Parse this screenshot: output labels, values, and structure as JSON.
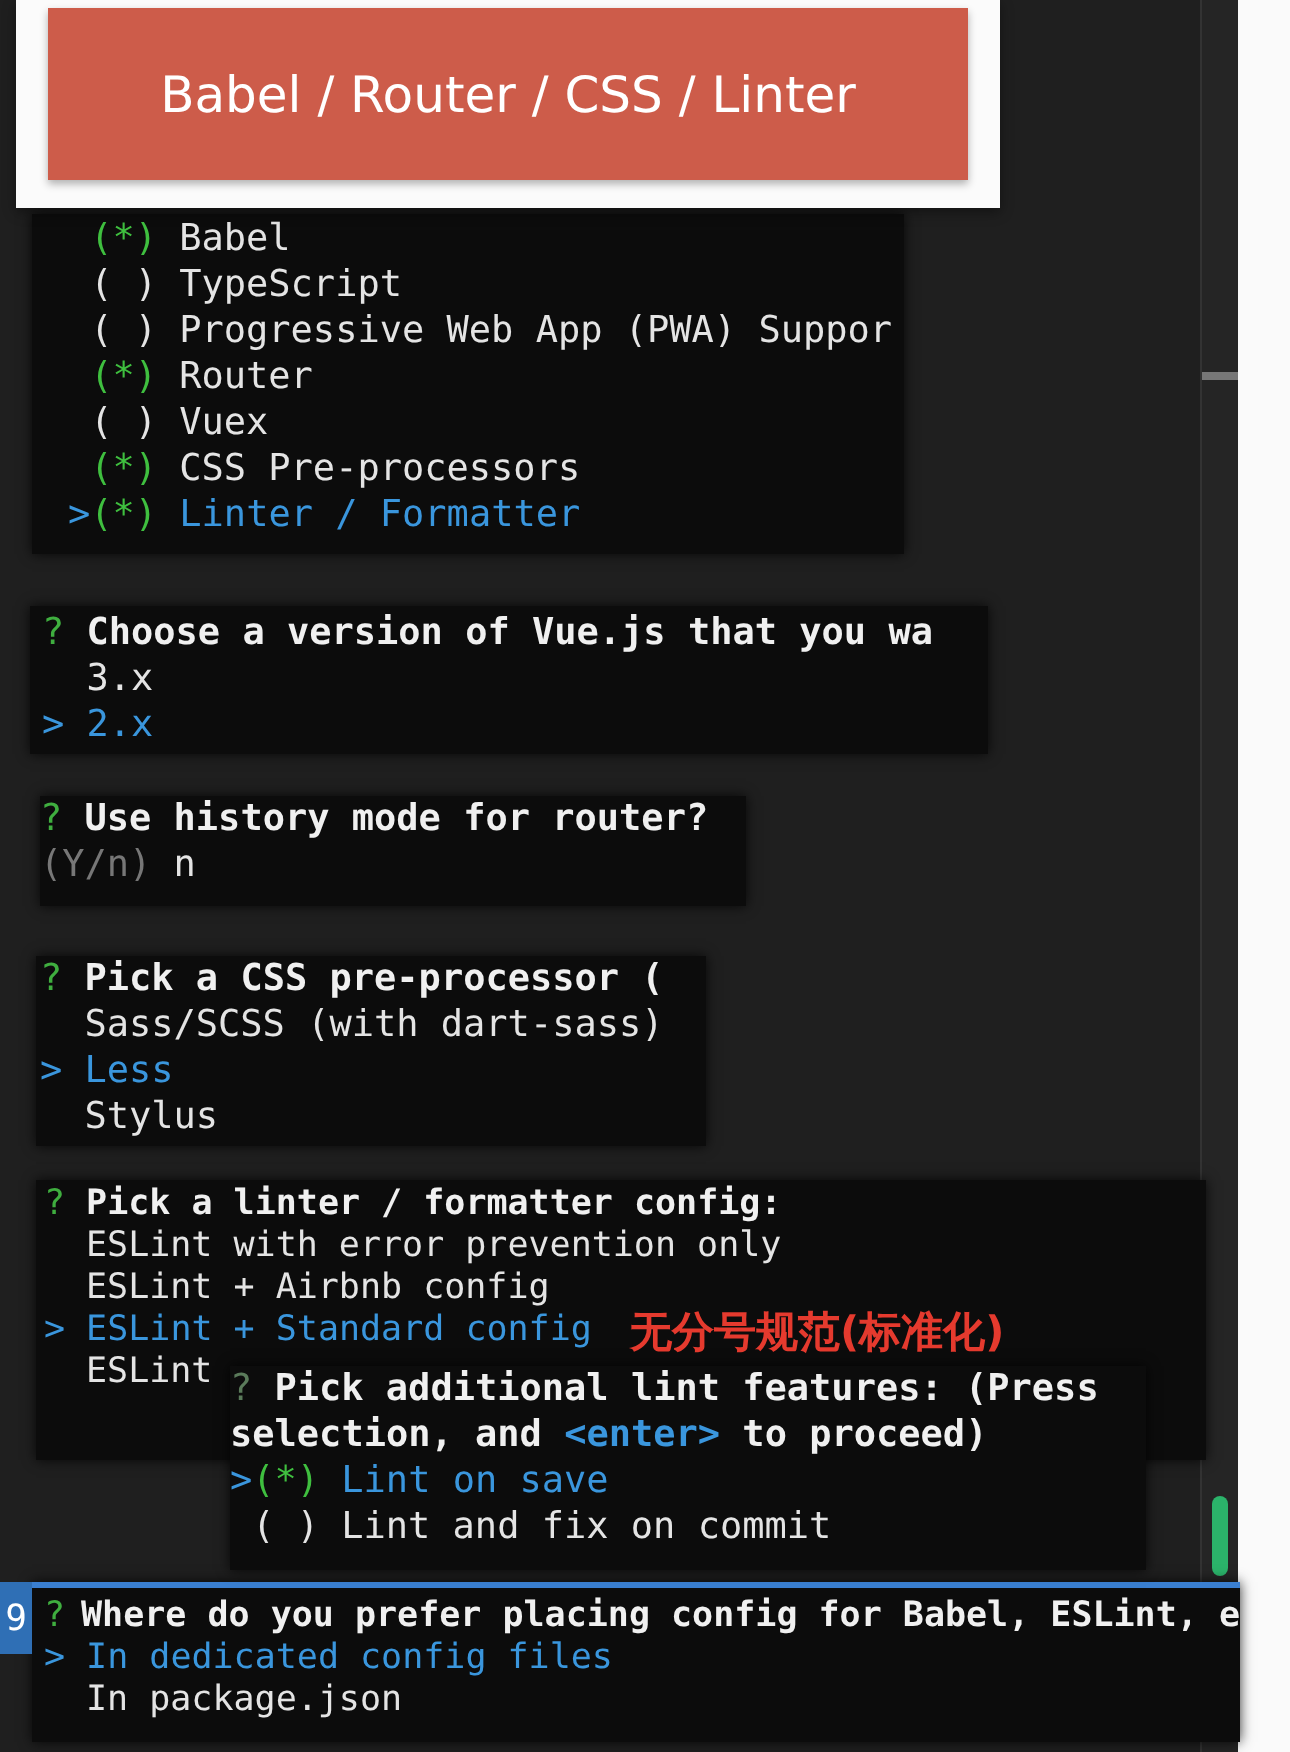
{
  "banner": {
    "title": "Babel / Router / CSS / Linter"
  },
  "panels": [
    {
      "kind": "checkbox_list",
      "pointer": ">",
      "items": [
        {
          "mark": "(*)",
          "label": "Babel",
          "checked": true,
          "selected": false
        },
        {
          "mark": "( )",
          "label": "TypeScript",
          "checked": false,
          "selected": false
        },
        {
          "mark": "( )",
          "label": "Progressive Web App (PWA) Suppor",
          "checked": false,
          "selected": false
        },
        {
          "mark": "(*)",
          "label": "Router",
          "checked": true,
          "selected": false
        },
        {
          "mark": "( )",
          "label": "Vuex",
          "checked": false,
          "selected": false
        },
        {
          "mark": "(*)",
          "label": "CSS Pre-processors",
          "checked": true,
          "selected": false
        },
        {
          "mark": "(*)",
          "label": "Linter / Formatter",
          "checked": true,
          "selected": true
        }
      ]
    },
    {
      "kind": "list",
      "prompt": "?",
      "question": "Choose a version of Vue.js that you wa",
      "pointer": ">",
      "options": [
        {
          "label": "3.x",
          "selected": false
        },
        {
          "label": "2.x",
          "selected": true
        }
      ]
    },
    {
      "kind": "confirm",
      "prompt": "?",
      "question": "Use history mode for router?",
      "hint": "(Y/n)",
      "answer": "n"
    },
    {
      "kind": "list",
      "prompt": "?",
      "question": "Pick a CSS pre-processor (",
      "pointer": ">",
      "options": [
        {
          "label": "Sass/SCSS (with dart-sass)",
          "selected": false
        },
        {
          "label": "Less",
          "selected": true
        },
        {
          "label": "Stylus",
          "selected": false
        }
      ]
    },
    {
      "kind": "list",
      "prompt": "?",
      "question": "Pick a linter / formatter config:",
      "pointer": ">",
      "annotation": "无分号规范(标准化)",
      "options": [
        {
          "label": "ESLint with error prevention only",
          "selected": false
        },
        {
          "label": "ESLint + Airbnb config",
          "selected": false
        },
        {
          "label": "ESLint + Standard config",
          "selected": true
        },
        {
          "label": "ESLint",
          "selected": false
        }
      ],
      "popup": {
        "prompt": "?",
        "question": "Pick additional lint features: (Press",
        "continuation": [
          {
            "text": "selection, and ",
            "highlight": false
          },
          {
            "text": "<enter>",
            "highlight": true
          },
          {
            "text": " to proceed)",
            "highlight": false
          }
        ],
        "pointer": ">",
        "items": [
          {
            "mark": "(*)",
            "label": "Lint on save",
            "checked": true,
            "selected": true
          },
          {
            "mark": "( )",
            "label": "Lint and fix on commit",
            "checked": false,
            "selected": false
          }
        ]
      }
    },
    {
      "kind": "list",
      "line_number": "9",
      "prompt": "?",
      "question": "Where do you prefer placing config for Babel, ESLint, e",
      "pointer": ">",
      "options": [
        {
          "label": "In dedicated config files",
          "selected": true
        },
        {
          "label": "In package.json",
          "selected": false
        }
      ]
    }
  ]
}
